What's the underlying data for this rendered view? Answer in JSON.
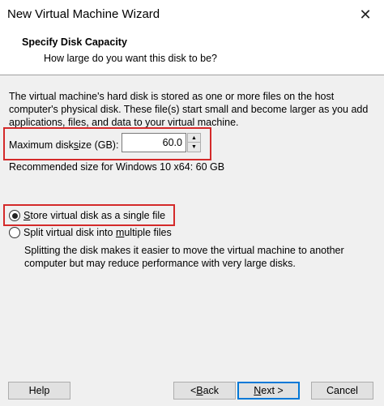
{
  "window": {
    "title": "New Virtual Machine Wizard",
    "close_glyph": "✕"
  },
  "header": {
    "title": "Specify Disk Capacity",
    "subtitle": "How large do you want this disk to be?"
  },
  "body": {
    "description": "The virtual machine's hard disk is stored as one or more files on the host computer's physical disk. These file(s) start small and become larger as you add applications, files, and data to your virtual machine.",
    "max_size_label_pre": "Maximum disk ",
    "max_size_label_ul": "s",
    "max_size_label_post": "ize (GB):",
    "max_size_value": "60.0",
    "recommended": "Recommended size for Windows 10 x64: 60 GB",
    "option_single_pre": "",
    "option_single_ul": "S",
    "option_single_post": "tore virtual disk as a single file",
    "option_single_selected": true,
    "option_multi_pre": "Split virtual disk into ",
    "option_multi_ul": "m",
    "option_multi_post": "ultiple files",
    "option_multi_selected": false,
    "split_description": "Splitting the disk makes it easier to move the virtual machine to another computer but may reduce performance with very large disks."
  },
  "footer": {
    "help": "Help",
    "back": "< Back",
    "back_pre": "< ",
    "back_ul": "B",
    "back_post": "ack",
    "next_pre": "",
    "next_ul": "N",
    "next_post": "ext >",
    "cancel": "Cancel"
  },
  "colors": {
    "highlight": "#d42a2a",
    "default_button_border": "#0078d7"
  },
  "icons": {
    "spin_up": "up-arrow-icon",
    "spin_down": "down-arrow-icon"
  }
}
